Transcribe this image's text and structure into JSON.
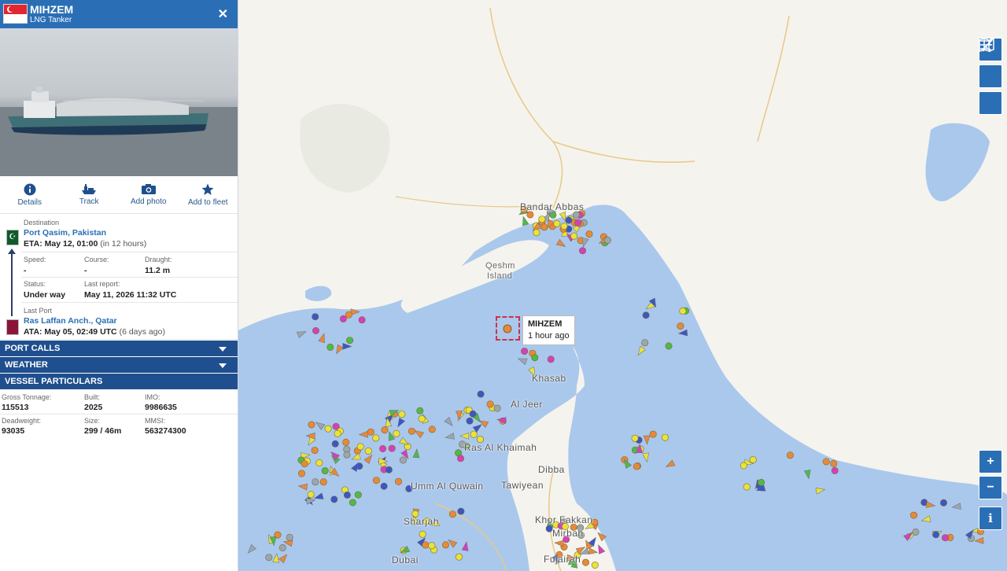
{
  "vessel": {
    "name": "MIHZEM",
    "type": "LNG Tanker",
    "close_label": "✕"
  },
  "actions": [
    {
      "label": "Details",
      "icon": "info-icon"
    },
    {
      "label": "Track",
      "icon": "ship-icon"
    },
    {
      "label": "Add photo",
      "icon": "camera-icon"
    },
    {
      "label": "Add to fleet",
      "icon": "star-icon"
    }
  ],
  "destination": {
    "label": "Destination",
    "port": "Port Qasim, Pakistan",
    "eta_label": "ETA: May 12, 01:00",
    "eta_relative": "(in 12 hours)"
  },
  "voyage": {
    "speed_label": "Speed:",
    "speed": "-",
    "course_label": "Course:",
    "course": "-",
    "draught_label": "Draught:",
    "draught": "11.2 m",
    "status_label": "Status:",
    "status": "Under way",
    "last_report_label": "Last report:",
    "last_report": "May 11, 2026 11:32 UTC"
  },
  "last_port": {
    "label": "Last Port",
    "port": "Ras Laffan Anch., Qatar",
    "ata_label": "ATA: May 05, 02:49 UTC",
    "ata_relative": "(6 days ago)"
  },
  "sections": {
    "port_calls": "PORT CALLS",
    "weather": "WEATHER",
    "particulars": "VESSEL PARTICULARS"
  },
  "particulars": {
    "gross_tonnage_label": "Gross Tonnage:",
    "gross_tonnage": "115513",
    "built_label": "Built:",
    "built": "2025",
    "imo_label": "IMO:",
    "imo": "9986635",
    "deadweight_label": "Deadweight:",
    "deadweight": "93035",
    "size_label": "Size:",
    "size": "299 / 46m",
    "mmsi_label": "MMSI:",
    "mmsi": "563274300"
  },
  "map": {
    "tooltip_name": "MIHZEM",
    "tooltip_time": "1 hour ago",
    "places": {
      "bandar_abbas": "Bandar Abbas",
      "qeshm": "Qeshm",
      "island": "Island",
      "khasab": "Khasab",
      "aljeer": "Al Jeer",
      "ras_al_khaimah": "Ras Al Khaimah",
      "umm_al_quwain": "Umm Al Quwain",
      "tawiyean": "Tawiyean",
      "dibba": "Dibba",
      "sharjah": "Sharjah",
      "dubai": "Dubai",
      "khor_fakkan": "Khor Fakkan",
      "mirbah": "Mirbah",
      "fujairah": "Fujairah"
    },
    "zoom_in": "+",
    "zoom_out": "−",
    "info": "i",
    "colors": {
      "sea": "#aac8ec",
      "land": "#f5f3ee",
      "tanker": "#e8893a",
      "cargo": "#e9e23b",
      "passenger": "#3b56c8",
      "highlight": "#c8344a"
    }
  }
}
